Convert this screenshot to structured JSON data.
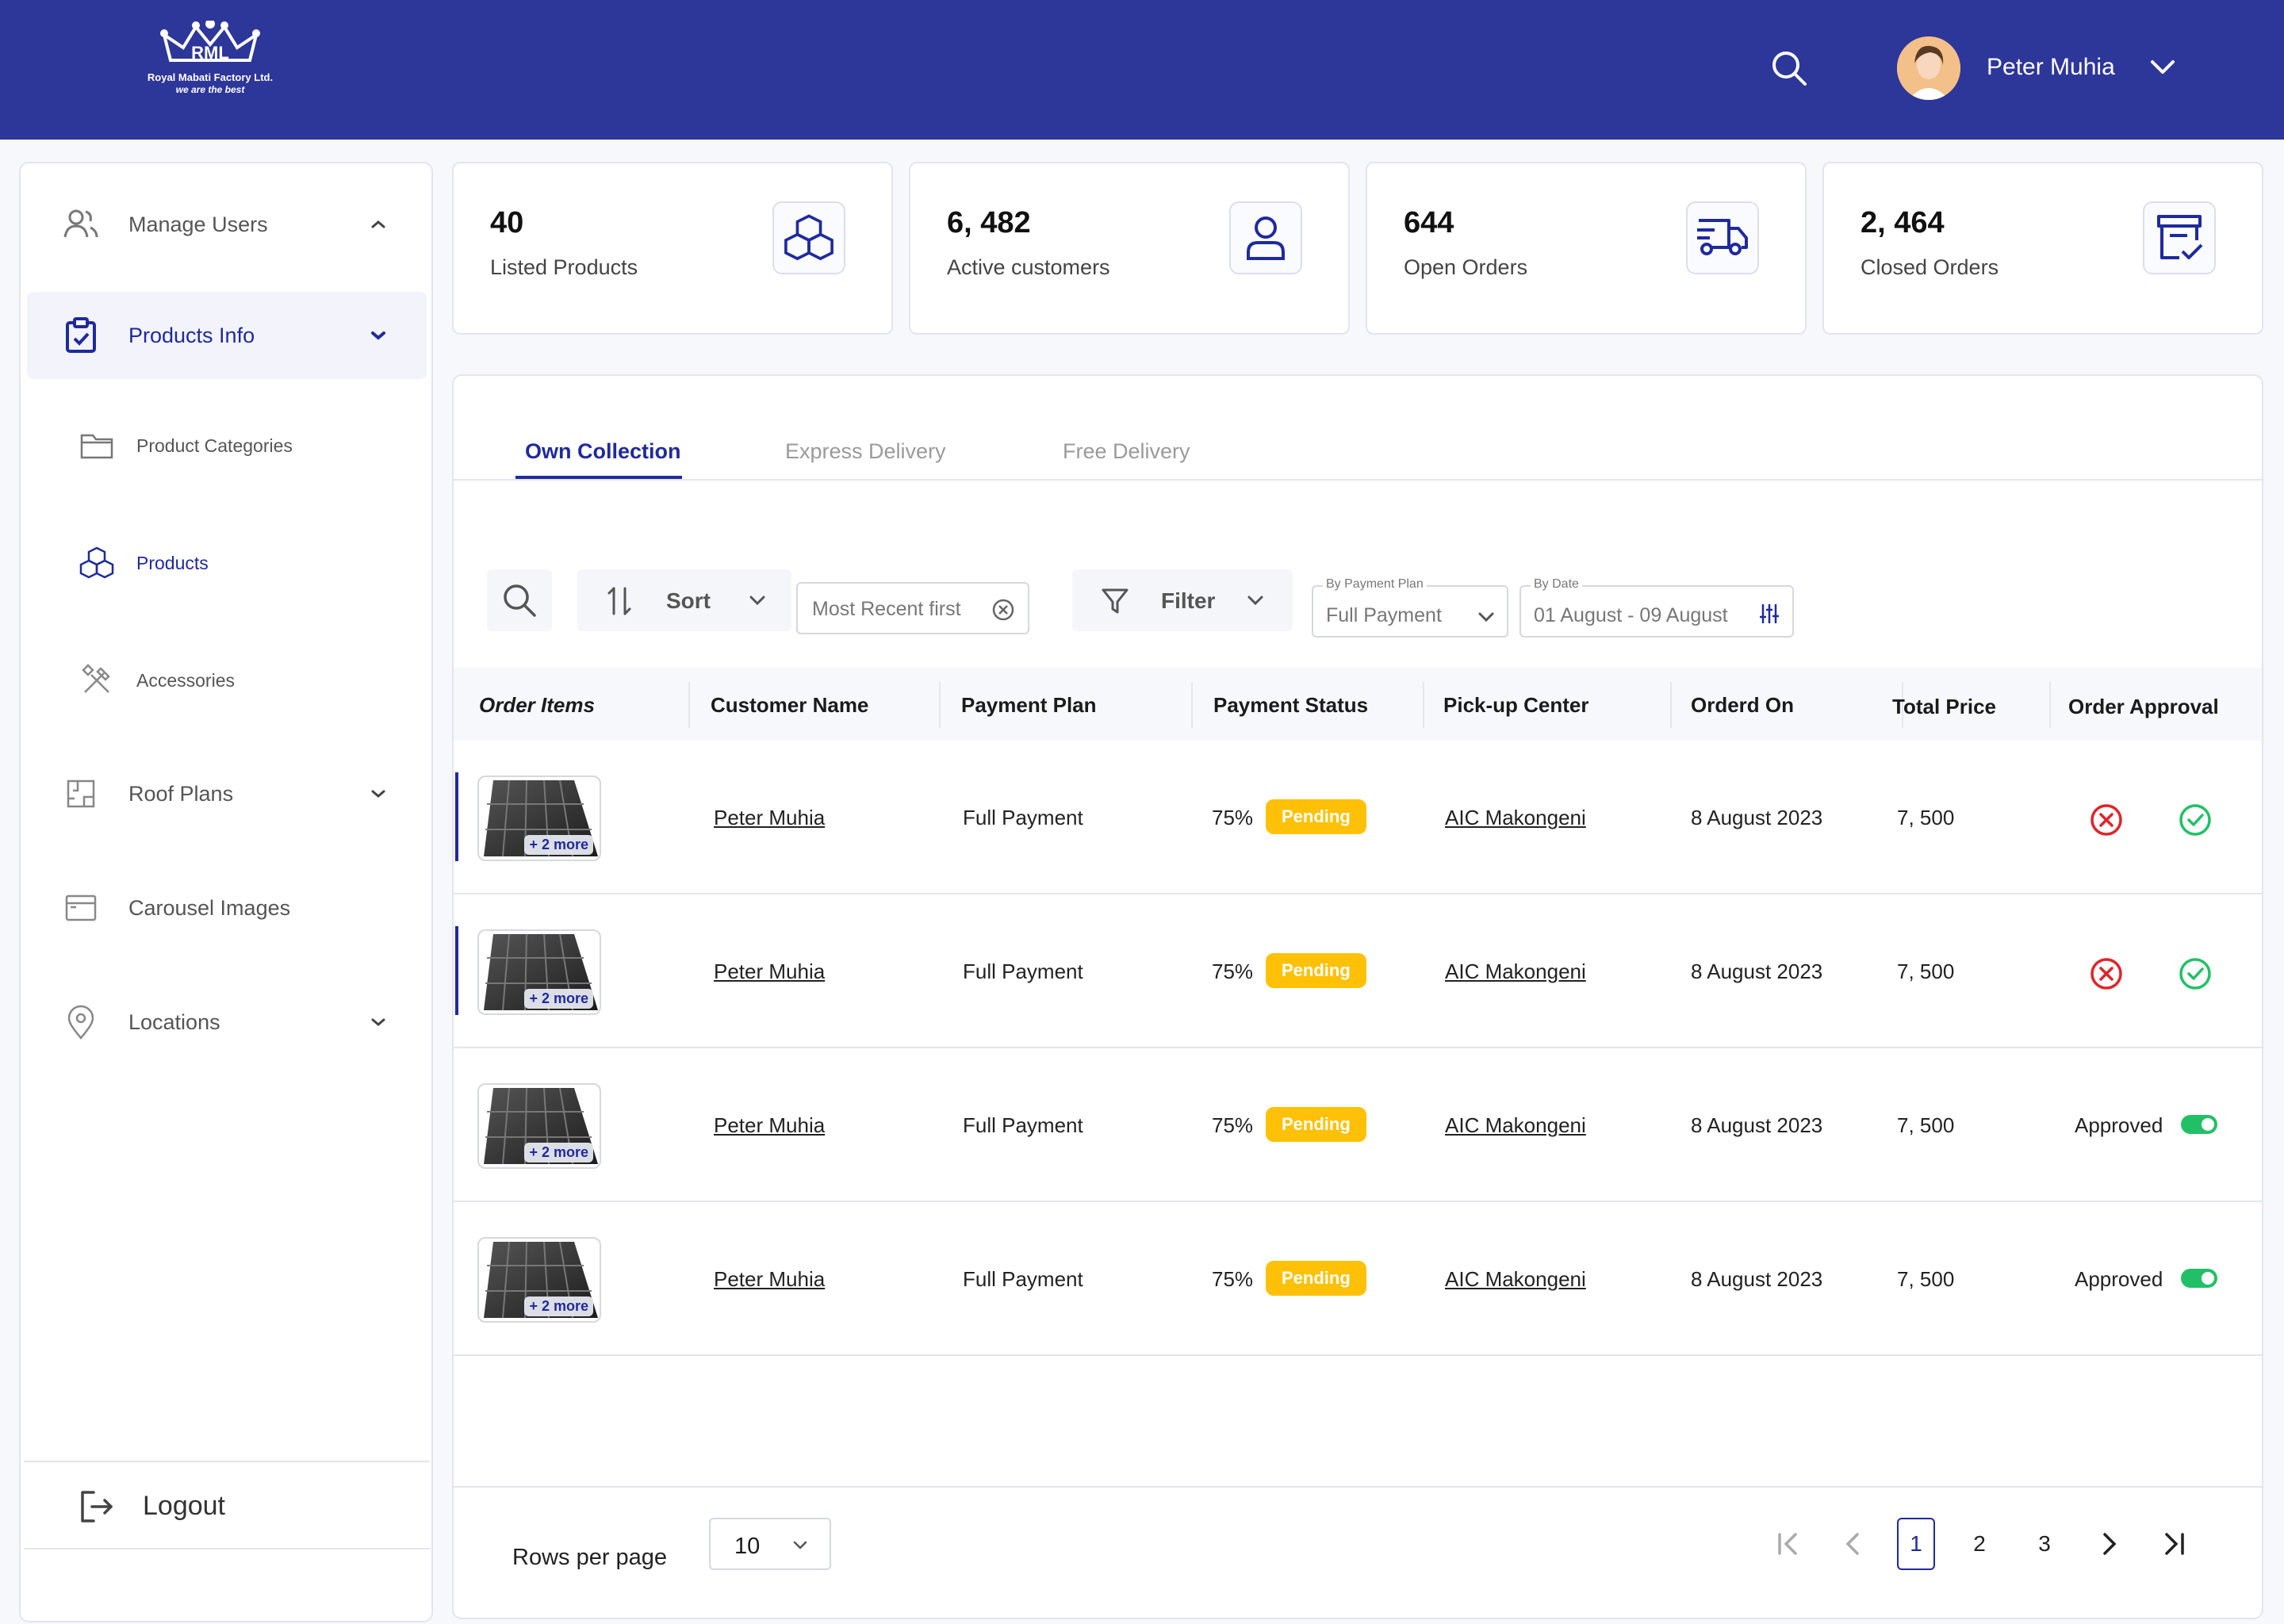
{
  "header": {
    "logo_text": "RML",
    "company": "Royal Mabati Factory Ltd.",
    "tagline": "we are the best",
    "user_name": "Peter Muhia"
  },
  "sidebar": {
    "items": [
      {
        "label": "Manage Users",
        "icon": "users-icon"
      },
      {
        "label": "Products Info",
        "icon": "clipboard-check-icon"
      },
      {
        "label": "Product Categories",
        "icon": "folder-icon"
      },
      {
        "label": "Products",
        "icon": "cubes-icon"
      },
      {
        "label": "Accessories",
        "icon": "tools-icon"
      },
      {
        "label": "Roof Plans",
        "icon": "floor-plan-icon"
      },
      {
        "label": "Carousel Images",
        "icon": "browser-window-icon"
      },
      {
        "label": "Locations",
        "icon": "map-pin-icon"
      }
    ],
    "logout_label": "Logout"
  },
  "stats": [
    {
      "value": "40",
      "label": "Listed Products",
      "icon": "cubes-icon"
    },
    {
      "value": "6, 482",
      "label": "Active customers",
      "icon": "user-icon"
    },
    {
      "value": "644",
      "label": "Open Orders",
      "icon": "delivery-truck-icon"
    },
    {
      "value": "2, 464",
      "label": "Closed Orders",
      "icon": "archive-check-icon"
    }
  ],
  "tabs": [
    "Own Collection",
    "Express Delivery",
    "Free Delivery"
  ],
  "toolbar": {
    "sort_label": "Sort",
    "sort_value": "Most Recent first",
    "filter_label": "Filter",
    "payment_plan_legend": "By Payment Plan",
    "payment_plan_value": "Full Payment",
    "date_legend": "By Date",
    "date_value": "01 August - 09 August"
  },
  "table": {
    "columns": [
      "Order Items",
      "Customer Name",
      "Payment Plan",
      "Payment Status",
      "Pick-up Center",
      "Orderd On",
      "Total Price",
      "Order Approval"
    ],
    "rows": [
      {
        "more": "+ 2 more",
        "customer": "Peter Muhia",
        "plan": "Full Payment",
        "percent": "75%",
        "status": "Pending",
        "center": "AIC Makongeni",
        "date": "8 August 2023",
        "price": "7, 500",
        "approval": "pending"
      },
      {
        "more": "+ 2 more",
        "customer": "Peter Muhia",
        "plan": "Full Payment",
        "percent": "75%",
        "status": "Pending",
        "center": "AIC Makongeni",
        "date": "8 August 2023",
        "price": "7, 500",
        "approval": "pending"
      },
      {
        "more": "+ 2 more",
        "customer": "Peter Muhia",
        "plan": "Full Payment",
        "percent": "75%",
        "status": "Pending",
        "center": "AIC Makongeni",
        "date": "8 August 2023",
        "price": "7, 500",
        "approval": "Approved"
      },
      {
        "more": "+ 2 more",
        "customer": "Peter Muhia",
        "plan": "Full Payment",
        "percent": "75%",
        "status": "Pending",
        "center": "AIC Makongeni",
        "date": "8 August 2023",
        "price": "7, 500",
        "approval": "Approved"
      }
    ]
  },
  "pagination": {
    "rows_per_page_label": "Rows per page",
    "rows_per_page": "10",
    "pages": [
      "1",
      "2",
      "3"
    ],
    "current_page": "1"
  },
  "colors": {
    "primary": "#2d3699",
    "accent_text": "#1f2a9c",
    "pending": "#ffc107",
    "approve": "#22c066",
    "reject": "#e0242b"
  }
}
